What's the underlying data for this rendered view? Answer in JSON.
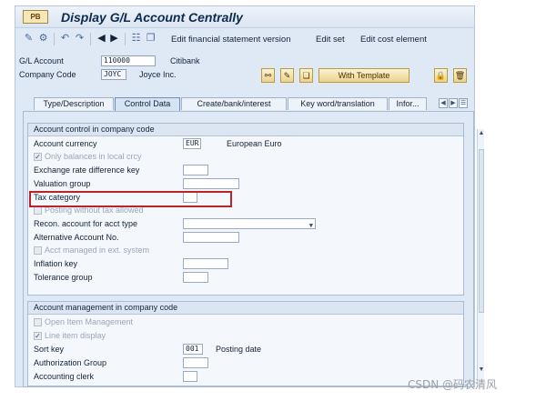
{
  "title": "Display G/L Account Centrally",
  "app_icon_text": "PB",
  "toolbar": {
    "edit_fs_version": "Edit financial statement version",
    "edit_set": "Edit set",
    "edit_cost_element": "Edit cost element"
  },
  "header": {
    "gl_account_label": "G/L Account",
    "gl_account_value": "110000",
    "gl_account_desc": "Citibank",
    "company_code_label": "Company Code",
    "company_code_value": "JOYC",
    "company_name": "Joyce Inc.",
    "with_template_label": "With Template"
  },
  "tabs": [
    "Type/Description",
    "Control Data",
    "Create/bank/interest",
    "Key word/translation",
    "Infor..."
  ],
  "active_tab": "Control Data",
  "account_control": {
    "title": "Account control in company code",
    "account_currency_label": "Account currency",
    "account_currency_value": "EUR",
    "account_currency_desc": "European Euro",
    "only_balances_label": "Only balances in local crcy",
    "exchange_rate_label": "Exchange rate difference key",
    "valuation_group_label": "Valuation group",
    "tax_category_label": "Tax category",
    "posting_without_tax_label": "Posting without tax allowed",
    "recon_account_label": "Recon. account for acct type",
    "alternative_account_label": "Alternative Account No.",
    "acct_managed_label": "Acct managed in ext. system",
    "inflation_key_label": "Inflation key",
    "tolerance_group_label": "Tolerance group"
  },
  "account_management": {
    "title": "Account management in company code",
    "open_item_label": "Open Item Management",
    "line_item_label": "Line item display",
    "sort_key_label": "Sort key",
    "sort_key_value": "001",
    "sort_key_desc": "Posting date",
    "auth_group_label": "Authorization Group",
    "accounting_clerk_label": "Accounting clerk"
  },
  "watermark": "CSDN @码农清风",
  "colors": {
    "highlight_border": "#c0202a",
    "tab_active": "#d6e3f2"
  }
}
